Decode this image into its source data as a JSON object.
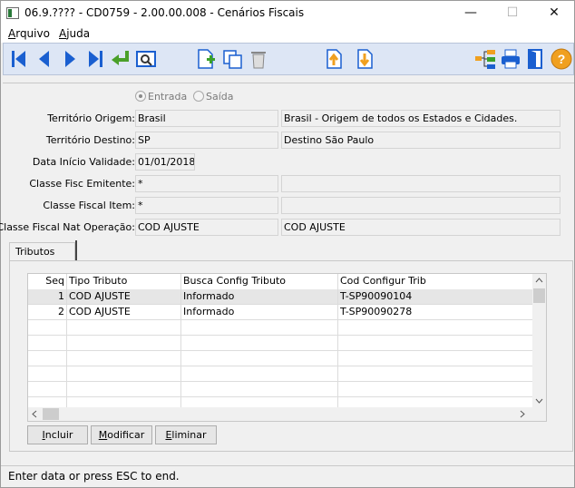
{
  "window": {
    "title": "06.9.???? - CD0759 - 2.00.00.008 - Cenários Fiscais",
    "minimize": "—",
    "maximize": "☐",
    "close": "✕"
  },
  "menu": [
    {
      "pre": "",
      "ul": "A",
      "post": "rquivo"
    },
    {
      "pre": "",
      "ul": "A",
      "post": "juda"
    }
  ],
  "form": {
    "radio_entrada": "Entrada",
    "radio_saida": "Saída",
    "territorio_origem_label": "Território Origem:",
    "territorio_origem_code": "Brasil",
    "territorio_origem_desc": "Brasil - Origem de todos os Estados e Cidades.",
    "territorio_destino_label": "Território Destino:",
    "territorio_destino_code": "SP",
    "territorio_destino_desc": "Destino São Paulo",
    "data_inicio_label": "Data Início Validade:",
    "data_inicio_value": "01/01/2018",
    "classe_emitente_label": "Classe Fisc Emitente:",
    "classe_emitente_value": "*",
    "classe_emitente_desc": "",
    "classe_item_label": "Classe Fiscal Item:",
    "classe_item_value": "*",
    "classe_item_desc": "",
    "classe_natop_label": "Classe Fiscal Nat Operação:",
    "classe_natop_value": "COD AJUSTE",
    "classe_natop_desc": "COD AJUSTE"
  },
  "tab": {
    "label": "Tributos"
  },
  "grid": {
    "columns": [
      "Seq",
      "Tipo Tributo",
      "Busca Config Tributo",
      "Cod Configur Trib"
    ],
    "rows": [
      [
        "1",
        "COD AJUSTE",
        "Informado",
        "T-SP90090104"
      ],
      [
        "2",
        "COD AJUSTE",
        "Informado",
        "T-SP90090278"
      ]
    ]
  },
  "buttons": {
    "incluir": {
      "pre": "",
      "ul": "I",
      "post": "ncluir"
    },
    "modificar": {
      "pre": "",
      "ul": "M",
      "post": "odificar"
    },
    "eliminar": {
      "pre": "",
      "ul": "E",
      "post": "liminar"
    }
  },
  "status": "Enter data or press ESC to end."
}
